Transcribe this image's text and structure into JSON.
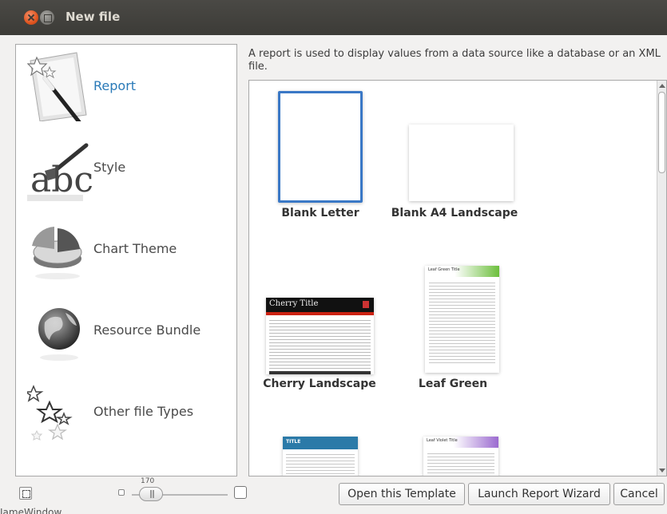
{
  "window": {
    "title": "New file"
  },
  "categories": [
    {
      "label": "Report",
      "icon": "magic-wand-icon",
      "selected": true
    },
    {
      "label": "Style",
      "icon": "brush-style-icon",
      "selected": false
    },
    {
      "label": "Chart Theme",
      "icon": "pie-chart-icon",
      "selected": false
    },
    {
      "label": "Resource Bundle",
      "icon": "globe-icon",
      "selected": false
    },
    {
      "label": "Other file Types",
      "icon": "stars-icon",
      "selected": false
    }
  ],
  "description": "A report is used to display values from a data source like a database or an XML file.",
  "templates": [
    {
      "name": "Blank Letter",
      "selected": true
    },
    {
      "name": "Blank A4 Landscape",
      "selected": false
    },
    {
      "name": "Cherry Landscape",
      "selected": false,
      "header_text": "Cherry Title"
    },
    {
      "name": "Leaf Green",
      "selected": false,
      "header_text": "Leaf Green Title"
    },
    {
      "name": "",
      "selected": false,
      "header_text": "TITLE"
    },
    {
      "name": "",
      "selected": false,
      "header_text": "Leaf Violet Title"
    }
  ],
  "zoom": {
    "value": "170"
  },
  "buttons": {
    "open_template": "Open this Template",
    "launch_wizard": "Launch Report Wizard",
    "cancel": "Cancel"
  },
  "status_text": "JameWindow",
  "colors": {
    "accent": "#3a78c6",
    "titlebar": "#3c3b37",
    "selected_label": "#2a7ab8"
  }
}
